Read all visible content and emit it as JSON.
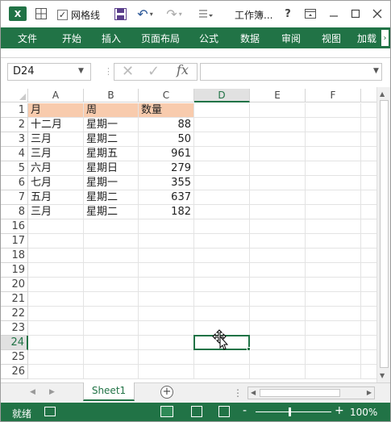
{
  "titlebar": {
    "app_icon_label": "X",
    "gridlines_label": "网格线",
    "gridlines_checked": "✓",
    "title": "工作簿...",
    "help": "?"
  },
  "ribbon": {
    "tabs": [
      {
        "label": "文件",
        "active": true
      },
      {
        "label": "开始"
      },
      {
        "label": "插入"
      },
      {
        "label": "页面布局"
      },
      {
        "label": "公式"
      },
      {
        "label": "数据"
      },
      {
        "label": "审阅"
      },
      {
        "label": "视图"
      },
      {
        "label": "加载"
      }
    ],
    "color": "#217346"
  },
  "formula_bar": {
    "name_box": "D24",
    "fx": "fx",
    "content": ""
  },
  "sheet": {
    "columns": [
      "A",
      "B",
      "C",
      "D",
      "E",
      "F"
    ],
    "selected_column": "D",
    "rows": [
      {
        "n": "1",
        "a": "月",
        "b": "周",
        "c": "数量",
        "header": true
      },
      {
        "n": "2",
        "a": "十二月",
        "b": "星期一",
        "c": "88"
      },
      {
        "n": "3",
        "a": "三月",
        "b": "星期二",
        "c": "50"
      },
      {
        "n": "4",
        "a": "三月",
        "b": "星期五",
        "c": "961"
      },
      {
        "n": "5",
        "a": "六月",
        "b": "星期日",
        "c": "279"
      },
      {
        "n": "6",
        "a": "七月",
        "b": "星期一",
        "c": "355"
      },
      {
        "n": "7",
        "a": "五月",
        "b": "星期二",
        "c": "637"
      },
      {
        "n": "8",
        "a": "三月",
        "b": "星期二",
        "c": "182"
      },
      {
        "n": "16"
      },
      {
        "n": "17"
      },
      {
        "n": "18"
      },
      {
        "n": "19"
      },
      {
        "n": "20"
      },
      {
        "n": "21"
      },
      {
        "n": "22"
      },
      {
        "n": "23"
      },
      {
        "n": "24",
        "selected": true
      },
      {
        "n": "25"
      },
      {
        "n": "26"
      }
    ],
    "header_fill": "#f8cbad",
    "active_cell": "D24"
  },
  "sheet_tabs": {
    "tabs": [
      "Sheet1"
    ],
    "add_label": "+",
    "separator": "⋮"
  },
  "status": {
    "text": "就绪",
    "zoom": "100%",
    "zoom_minus": "-",
    "zoom_plus": "+"
  }
}
